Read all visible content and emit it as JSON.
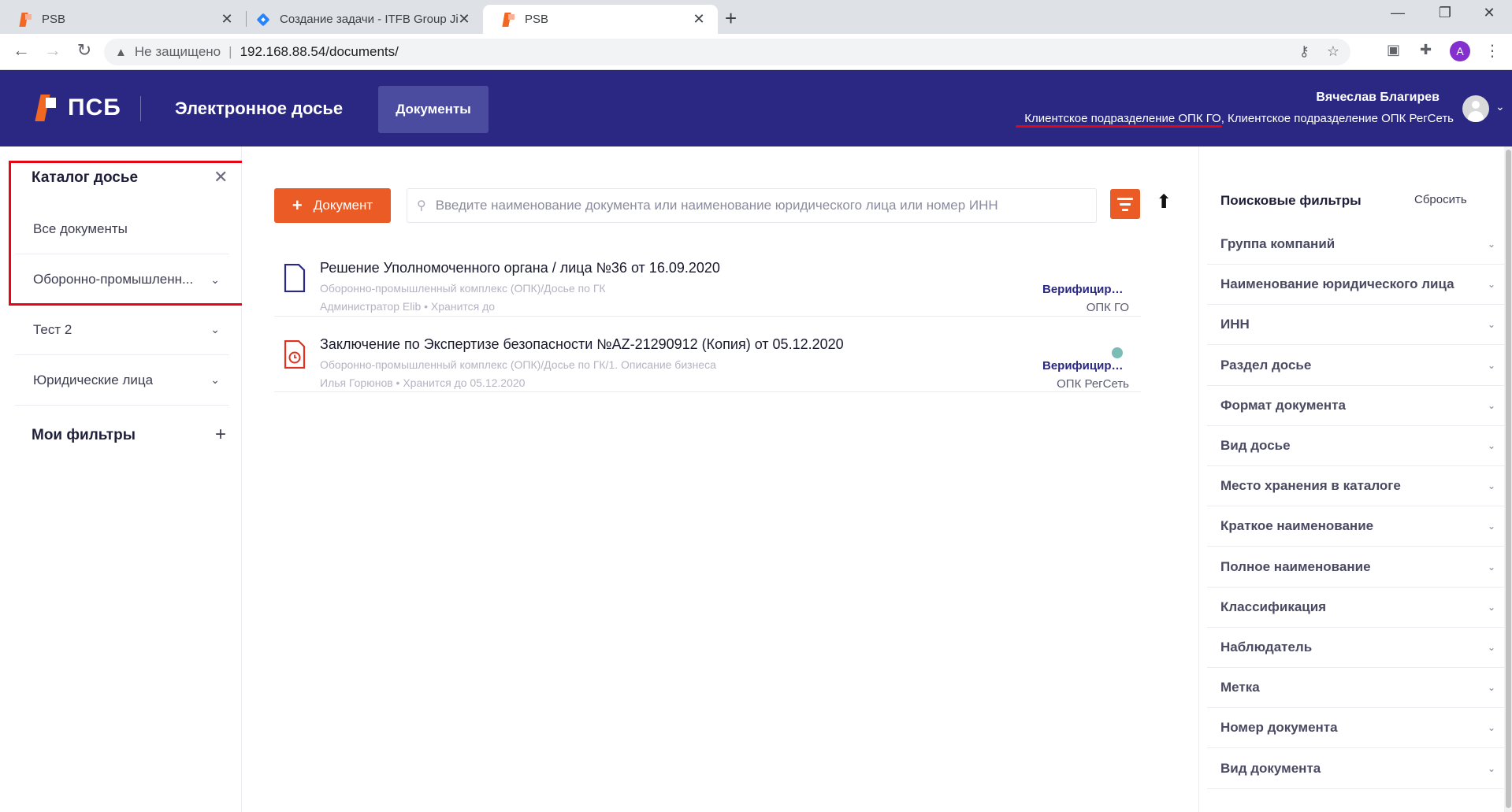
{
  "browser": {
    "tabs": [
      {
        "title": "PSB",
        "active": false
      },
      {
        "title": "Создание задачи - ITFB Group Ji",
        "active": false
      },
      {
        "title": "PSB",
        "active": true
      }
    ],
    "insecure_label": "Не защищено",
    "url": "192.168.88.54/documents/",
    "profile_initial": "A"
  },
  "header": {
    "logo_text": "ПСБ",
    "app_title": "Электронное досье",
    "nav_documents": "Документы",
    "user_name": "Вячеслав Благирев",
    "user_dept": "Клиентское подразделение ОПК ГО, Клиентское подразделение ОПК РегСеть",
    "bg_color": "#2a2882",
    "accent_color": "#ea5b25"
  },
  "sidebar": {
    "catalog_title": "Каталог досье",
    "items": [
      {
        "label": "Все документы",
        "has_chevron": false
      },
      {
        "label": "Оборонно-промышленн...",
        "has_chevron": true
      },
      {
        "label": "Тест 2",
        "has_chevron": true
      },
      {
        "label": "Юридические лица",
        "has_chevron": true
      }
    ],
    "my_filters": "Мои фильтры"
  },
  "toolbar": {
    "add_document_label": "Документ",
    "search_placeholder": "Введите наименование документа или наименование юридического лица или номер ИНН"
  },
  "documents": [
    {
      "title": "Решение Уполномоченного органа / лица №36 от 16.09.2020",
      "path": "Оборонно-промышленный комплекс (ОПК)/Досье по ГК",
      "meta": "Администратор Elib • Хранится до",
      "status": "Верифицировано",
      "dept": "ОПК ГО",
      "icon": "document-icon",
      "has_dot": false
    },
    {
      "title": "Заключение по Экспертизе безопасности №AZ-21290912 (Копия) от 05.12.2020",
      "path": "Оборонно-промышленный комплекс (ОПК)/Досье по ГК/1. Описание бизнеса",
      "meta": "Илья Горюнов • Хранится до 05.12.2020",
      "status": "Верифицировано",
      "dept": "ОПК РегСеть",
      "icon": "clock-document-icon",
      "has_dot": true
    }
  ],
  "filters": {
    "title": "Поисковые фильтры",
    "reset_label": "Сбросить",
    "items": [
      "Группа компаний",
      "Наименование юридического лица",
      "ИНН",
      "Раздел досье",
      "Формат документа",
      "Вид досье",
      "Место хранения в каталоге",
      "Краткое наименование",
      "Полное наименование",
      "Классификация",
      "Наблюдатель",
      "Метка",
      "Номер документа",
      "Вид документа"
    ]
  }
}
